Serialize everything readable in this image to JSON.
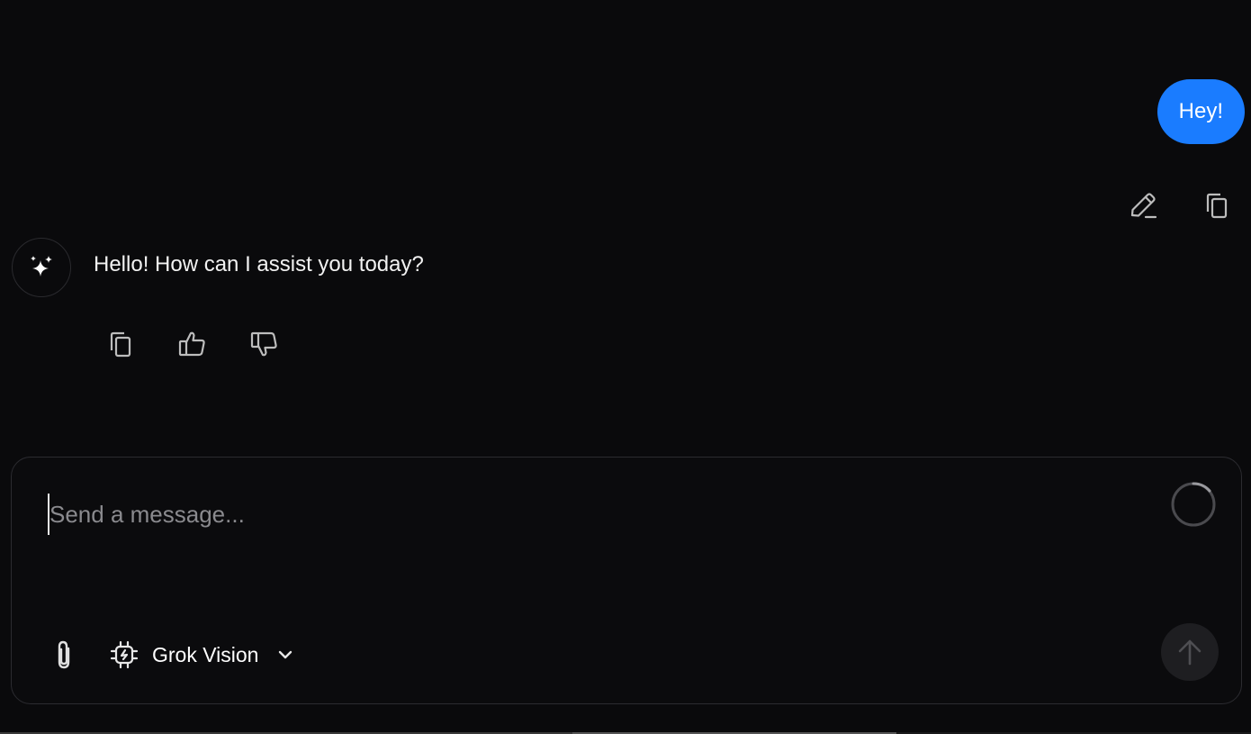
{
  "conversation": {
    "user_message": "Hey!",
    "assistant_message": "Hello! How can I assist you today?"
  },
  "user_actions": {
    "edit_icon": "pencil-icon",
    "copy_icon": "copy-icon"
  },
  "assistant_actions": {
    "copy_icon": "copy-icon",
    "like_icon": "thumbs-up-icon",
    "dislike_icon": "thumbs-down-icon"
  },
  "composer": {
    "placeholder": "Send a message...",
    "value": "",
    "model_label": "Grok Vision",
    "attach_icon": "paperclip-icon",
    "model_icon": "chip-icon",
    "send_icon": "arrow-up-icon",
    "status_icon": "loading-spinner-icon"
  },
  "colors": {
    "background": "#0a0a0c",
    "user_bubble": "#1a7cff",
    "composer_border": "#2b2b30",
    "send_button": "#1e1e21"
  }
}
